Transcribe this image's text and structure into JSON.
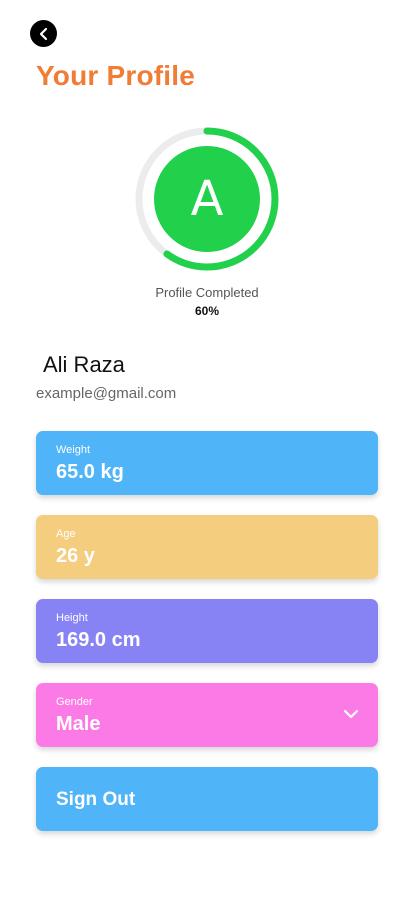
{
  "header": {
    "back_icon": "chevron-left-icon",
    "title": "Your Profile"
  },
  "profile": {
    "avatar_initial": "A",
    "completion_label": "Profile Completed",
    "completion_text": "60%",
    "completion_fraction": 0.6,
    "name": "Ali Raza",
    "email": "example@gmail.com"
  },
  "cards": {
    "weight": {
      "label": "Weight",
      "value": "65.0 kg"
    },
    "age": {
      "label": "Age",
      "value": "26 y"
    },
    "height": {
      "label": "Height",
      "value": "169.0 cm"
    },
    "gender": {
      "label": "Gender",
      "value": "Male",
      "icon": "chevron-down-icon"
    }
  },
  "actions": {
    "sign_out_label": "Sign Out"
  },
  "colors": {
    "accent_title": "#f07c35",
    "progress_green": "#21d04b",
    "progress_track": "#ececec",
    "weight_card": "#50b4f8",
    "age_card": "#f5cd7e",
    "height_card": "#8783f5",
    "gender_card": "#fc7ae6",
    "signout_button": "#50b4f8"
  }
}
